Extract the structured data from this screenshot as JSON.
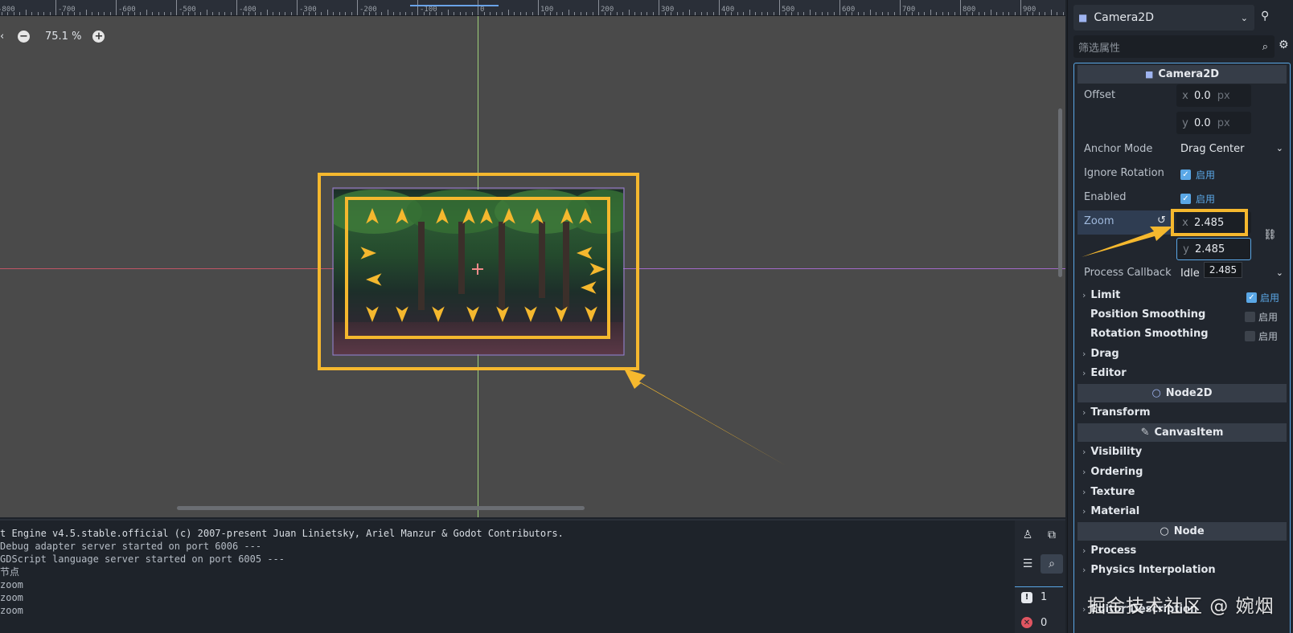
{
  "viewport": {
    "ruler_labels": [
      "-800",
      "-700",
      "-600",
      "-500",
      "-400",
      "-300",
      "-200",
      "-100",
      "0",
      "100",
      "200",
      "300",
      "400",
      "500",
      "600",
      "700",
      "800",
      "900"
    ],
    "zoom_level": "75.1 %",
    "zoom_out": "−",
    "zoom_in": "+",
    "nav_glyph": "‹"
  },
  "output": {
    "lines": [
      "t Engine v4.5.stable.official (c) 2007-present Juan Linietsky, Ariel Manzur & Godot Contributors.",
      "Debug adapter server started on port 6006 ---",
      "GDScript language server started on port 6005 ---",
      "节点",
      " zoom",
      " zoom",
      " zoom"
    ],
    "warning_count": "1",
    "error_count": "0"
  },
  "inspector": {
    "node_name": "Camera2D",
    "filter_placeholder": "筛选属性",
    "sections": {
      "camera2d": "Camera2D",
      "node2d": "Node2D",
      "canvasitem": "CanvasItem",
      "node": "Node"
    },
    "props": {
      "offset_label": "Offset",
      "offset_x": "0.0",
      "offset_y": "0.0",
      "unit_px": "px",
      "axis_x": "x",
      "axis_y": "y",
      "anchor_mode_label": "Anchor Mode",
      "anchor_mode_value": "Drag Center",
      "ignore_rotation_label": "Ignore Rotation",
      "enabled_label": "Enabled",
      "on_text": "启用",
      "zoom_label": "Zoom",
      "zoom_x": "2.485",
      "zoom_y": "2.485",
      "tooltip": "2.485",
      "process_callback_label": "Process Callback",
      "process_callback_value": "Idle"
    },
    "groups": {
      "limit": "Limit",
      "position_smoothing": "Position Smoothing",
      "rotation_smoothing": "Rotation Smoothing",
      "drag": "Drag",
      "editor": "Editor",
      "transform": "Transform",
      "visibility": "Visibility",
      "ordering": "Ordering",
      "texture": "Texture",
      "material": "Material",
      "process": "Process",
      "physics_interpolation": "Physics Interpolation",
      "editor_description": "Editor Description"
    }
  },
  "watermark": "掘金技术社区 @ 婉烟",
  "colors": {
    "highlight": "#f5b82e",
    "accent": "#5aa7e6"
  }
}
